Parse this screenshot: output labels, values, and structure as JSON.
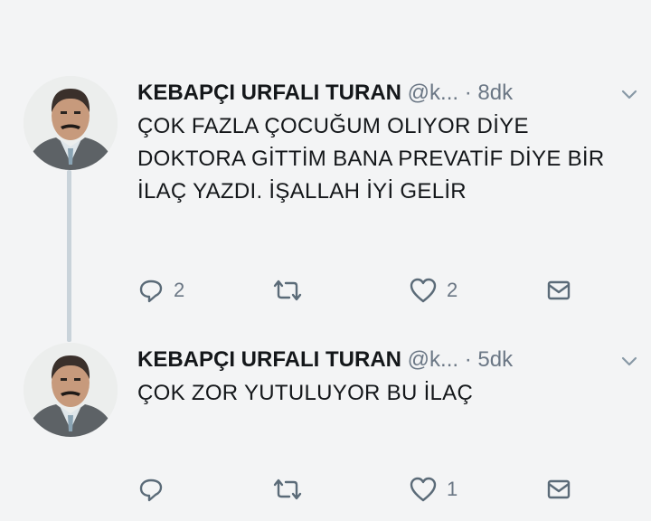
{
  "tweets": [
    {
      "display_name": "KEBAPÇI URFALI TURAN",
      "handle": "@k...",
      "separator": "·",
      "time": "8dk",
      "text": "ÇOK FAZLA ÇOCUĞUM OLIYOR DİYE DOKTORA GİTTİM BANA PREVATİF DİYE BİR İLAÇ YAZDI. İŞALLAH İYİ GELİR",
      "reply_count": "2",
      "retweet_count": "",
      "like_count": "2"
    },
    {
      "display_name": "KEBAPÇI URFALI TURAN",
      "handle": "@k...",
      "separator": "·",
      "time": "5dk",
      "text": "ÇOK ZOR YUTULUYOR BU İLAÇ",
      "reply_count": "",
      "retweet_count": "",
      "like_count": "1"
    }
  ],
  "icons": {
    "reply": "reply-icon",
    "retweet": "retweet-icon",
    "like": "heart-icon",
    "dm": "envelope-icon",
    "more": "chevron-down-icon"
  },
  "colors": {
    "text": "#14171a",
    "muted": "#6b7785",
    "thread_line": "#c9d3da",
    "background": "#f3f4f5"
  }
}
